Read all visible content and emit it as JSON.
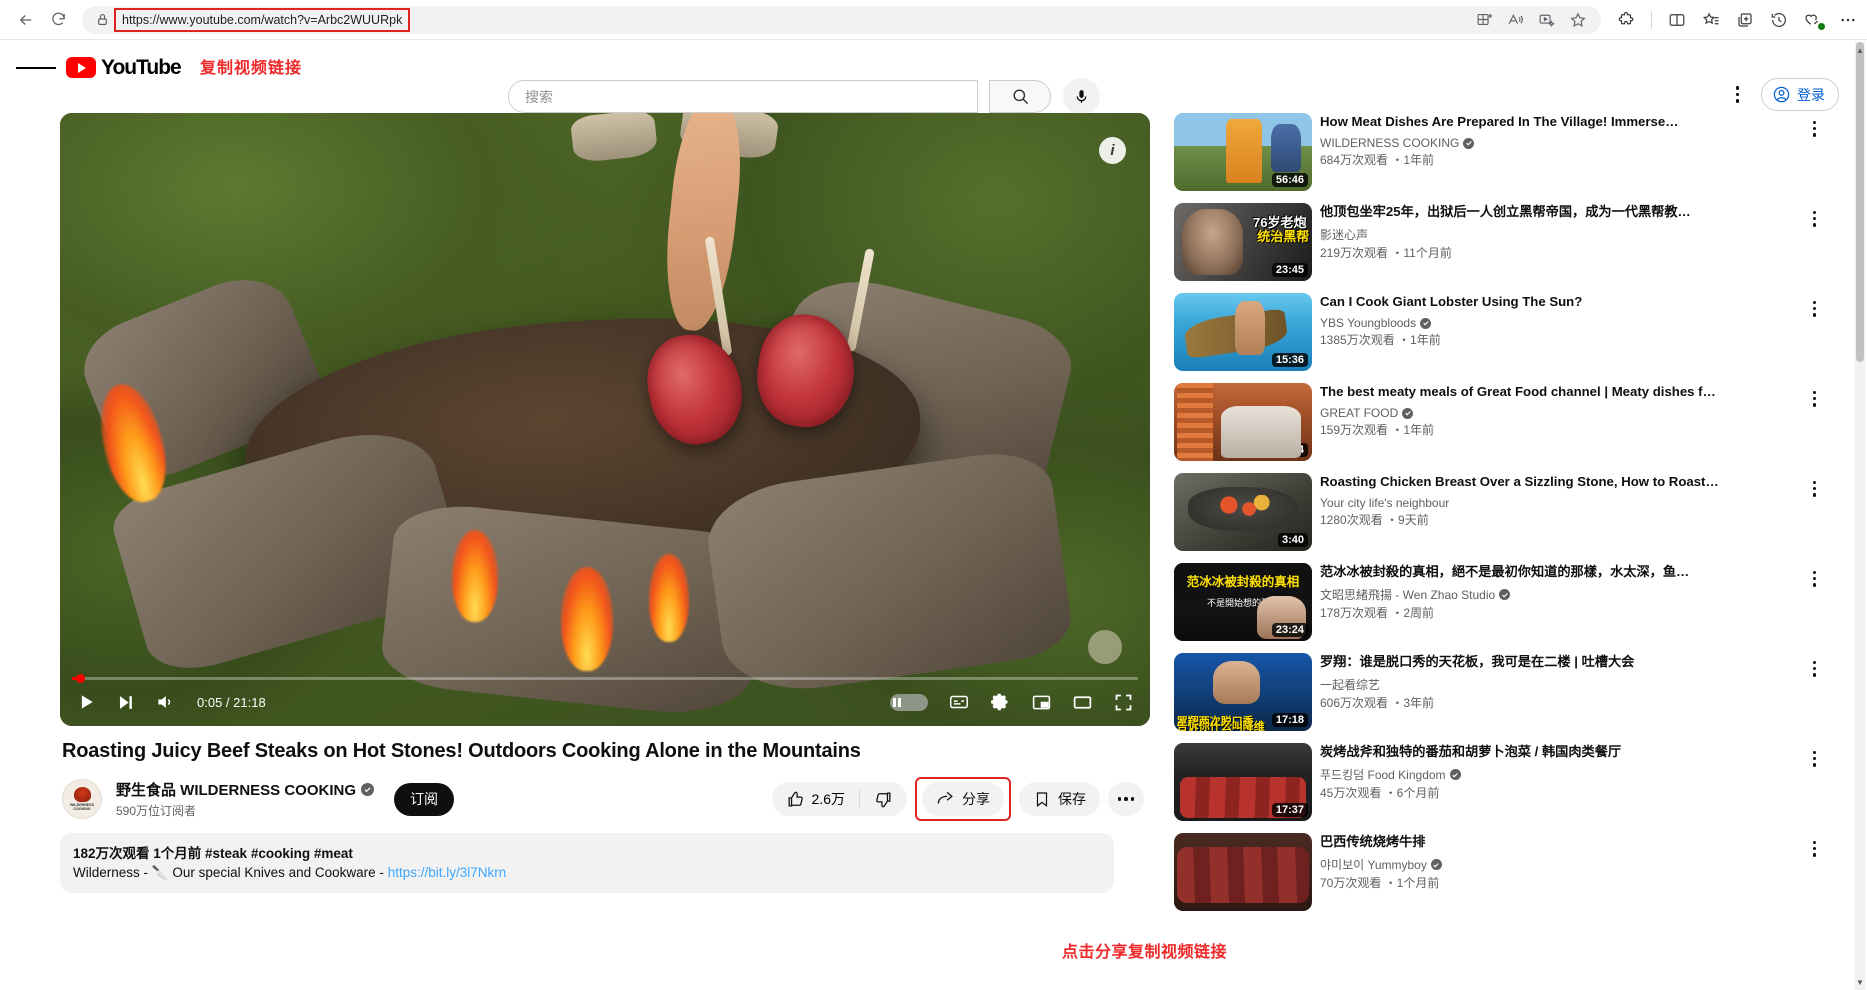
{
  "browser": {
    "url": "https://www.youtube.com/watch?v=Arbc2WUURpk",
    "back_label": "Back",
    "refresh_label": "Refresh",
    "icons": {
      "lock": "lock-icon",
      "split_screen": "split-screen-icon",
      "read_aloud": "read-aloud-icon",
      "video_enhance": "video-enhance-icon",
      "favorite_star": "star-icon",
      "extensions": "extensions-icon",
      "favorites_list": "favorites-list-icon",
      "collections": "collections-icon",
      "history": "history-icon",
      "browser_essentials": "browser-essentials-icon",
      "settings_more": "settings-more-icon"
    }
  },
  "annotations": {
    "top": "复制视频链接",
    "share": "点击分享复制视频链接"
  },
  "header": {
    "logo_text": "YouTube",
    "search_placeholder": "搜索",
    "search_button": "search-icon",
    "mic_button": "microphone-icon",
    "more_button": "more-vertical-icon",
    "signin_label": "登录"
  },
  "player": {
    "current_time": "0:05",
    "total_time": "21:18",
    "time_display": "0:05 / 21:18",
    "progress_percent": 0.4,
    "info_badge": "i",
    "controls": {
      "play": "play-icon",
      "next": "next-icon",
      "volume": "volume-icon",
      "autoplay": "autoplay-toggle",
      "subtitles": "subtitles-icon",
      "settings": "settings-gear-icon",
      "miniplayer": "miniplayer-icon",
      "theater": "theater-mode-icon",
      "fullscreen": "fullscreen-icon"
    }
  },
  "video": {
    "title": "Roasting Juicy Beef Steaks on Hot Stones! Outdoors Cooking Alone in the Mountains",
    "channel_name": "野生食品 WILDERNESS COOKING",
    "channel_avatar_caption": "WILDERNESS COOKING",
    "subscribers": "590万位订阅者",
    "subscribe_label": "订阅",
    "like_count": "2.6万",
    "dislike_label": "dislike",
    "share_label": "分享",
    "save_label": "保存",
    "description_meta": "182万次观看  1个月前  #steak #cooking #meat",
    "description_text": "Wilderness - 🔪 Our special Knives and Cookware - ",
    "description_link": "https://bit.ly/3l7Nkrn"
  },
  "sidebar": {
    "items": [
      {
        "title": "How Meat Dishes Are Prepared In The Village! Immerse…",
        "channel": "WILDERNESS COOKING",
        "verified": true,
        "stats": "684万次观看 ・1年前",
        "duration": "56:46",
        "thumb_class": "t1",
        "caption_main": "",
        "caption_sub": ""
      },
      {
        "title": "他顶包坐牢25年，出狱后一人创立黑帮帝国，成为一代黑帮教…",
        "channel": "影迷心声",
        "verified": false,
        "stats": "219万次观看 ・11个月前",
        "duration": "23:45",
        "thumb_class": "t2",
        "caption_main": "76岁老炮",
        "caption_sub": "统治黑帮"
      },
      {
        "title": "Can I Cook Giant Lobster Using The Sun?",
        "channel": "YBS Youngbloods",
        "verified": true,
        "stats": "1385万次观看 ・1年前",
        "duration": "15:36",
        "thumb_class": "t3",
        "caption_main": "",
        "caption_sub": ""
      },
      {
        "title": "The best meaty meals of Great Food channel | Meaty dishes f…",
        "channel": "GREAT FOOD",
        "verified": true,
        "stats": "159万次观看 ・1年前",
        "duration": "2:45:24",
        "thumb_class": "t4",
        "caption_main": "",
        "caption_sub": ""
      },
      {
        "title": "Roasting Chicken Breast Over a Sizzling Stone, How to Roast…",
        "channel": "Your city life's neighbour",
        "verified": false,
        "stats": "1280次观看 ・9天前",
        "duration": "3:40",
        "thumb_class": "t5",
        "caption_main": "",
        "caption_sub": ""
      },
      {
        "title": "范冰冰被封殺的真相，絕不是最初你知道的那樣，水太深，鱼…",
        "channel": "文昭思緒飛揚 - Wen Zhao Studio",
        "verified": true,
        "stats": "178万次观看 ・2周前",
        "duration": "23:24",
        "thumb_class": "t6",
        "caption_main": "范冰冰被封殺的真相",
        "caption_sub": "不是開始想的那樣"
      },
      {
        "title": "罗翔：谁是脱口秀的天花板，我可是在二楼 | 吐槽大会",
        "channel": "一起看综艺",
        "verified": false,
        "stats": "606万次观看 ・3年前",
        "duration": "17:18",
        "thumb_class": "t7",
        "caption_main": "罗翔两次脱口秀",
        "caption_sub": "告诉你什么叫降维"
      },
      {
        "title": "炭烤战斧和独特的番茄和胡萝卜泡菜 / 韩国肉类餐厅",
        "channel": "푸드킹덤 Food Kingdom",
        "verified": true,
        "stats": "45万次观看 ・6个月前",
        "duration": "17:37",
        "thumb_class": "t8",
        "caption_main": "",
        "caption_sub": ""
      },
      {
        "title": "巴西传统烧烤牛排",
        "channel": "야미보이 Yummyboy",
        "verified": true,
        "stats": "70万次观看 ・1个月前",
        "duration": "",
        "thumb_class": "t9",
        "caption_main": "",
        "caption_sub": ""
      }
    ]
  },
  "colors": {
    "youtube_red": "#ff0000",
    "annotation_red": "#ef2a2a",
    "link_blue": "#3ea6ff",
    "signin_blue": "#065fd4"
  }
}
